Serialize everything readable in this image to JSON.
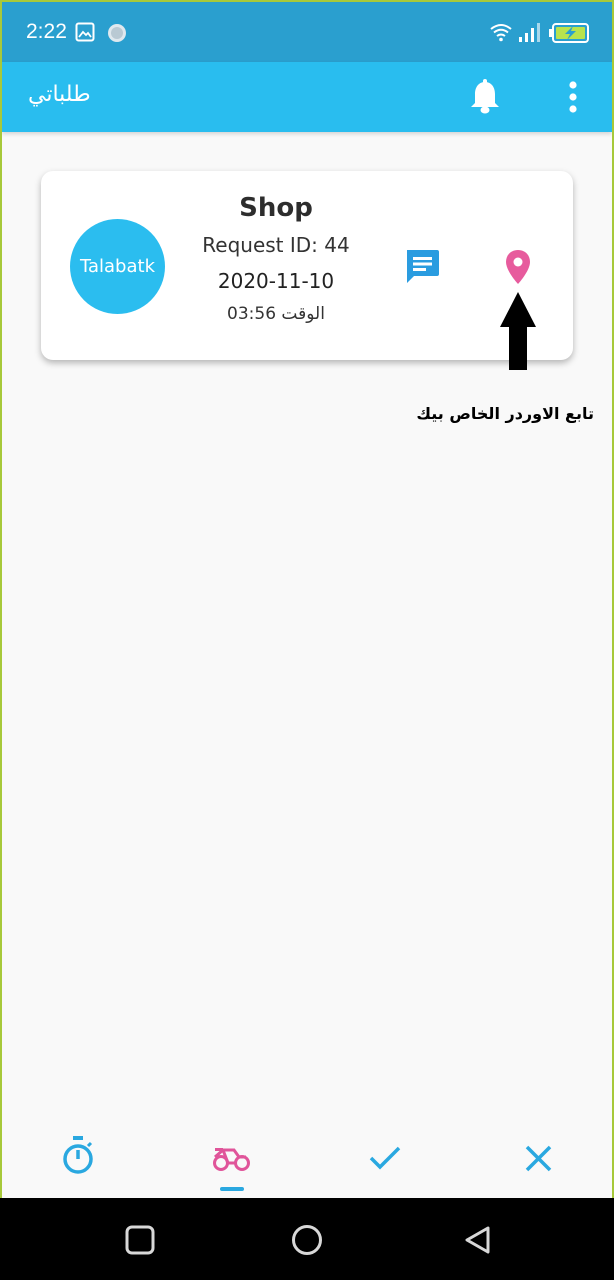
{
  "status_bar": {
    "time": "2:22",
    "icons": [
      "image-icon",
      "sync-circle-icon",
      "wifi-icon",
      "signal-icon",
      "battery-charging-icon"
    ]
  },
  "app_bar": {
    "title": "طلباتي",
    "actions": [
      "bell-icon",
      "more-vert-icon"
    ],
    "color": "#29bdef"
  },
  "order_card": {
    "logo_text": "Talabatk",
    "shop_name": "Shop",
    "request_id": "Request ID: 44",
    "date": "2020-11-10",
    "time": "الوقت 03:56",
    "actions": [
      "chat-icon",
      "location-pin-icon"
    ]
  },
  "annotation": {
    "text": "تابع الاوردر الخاص بيك"
  },
  "bottom_nav": {
    "items": [
      "timer-icon",
      "motorcycle-icon",
      "check-icon",
      "close-icon"
    ],
    "active_index": 1,
    "colors": {
      "default": "#2aa8e0",
      "active": "#e0559a"
    }
  },
  "system_nav": {
    "items": [
      "recent-apps-icon",
      "home-icon",
      "back-icon"
    ]
  }
}
